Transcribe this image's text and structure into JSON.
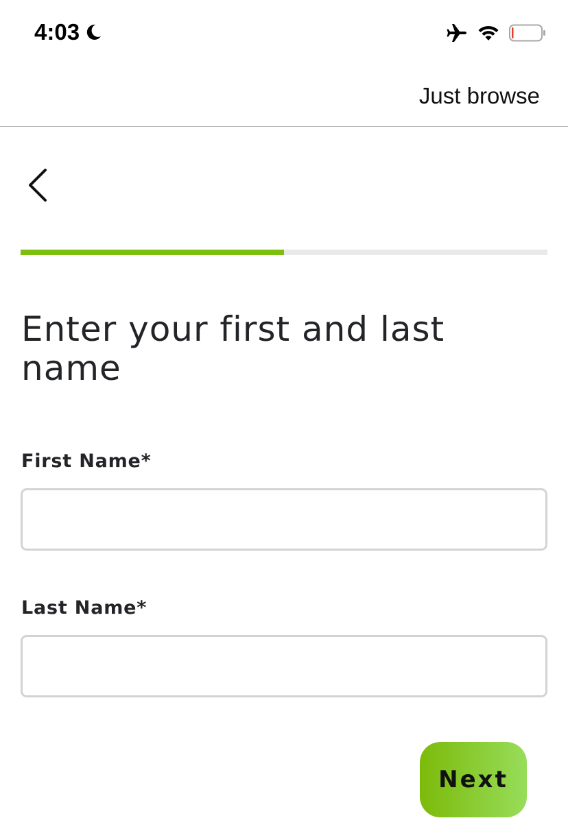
{
  "status_bar": {
    "time": "4:03",
    "icons": [
      "moon-icon",
      "airplane-icon",
      "wifi-icon",
      "battery-icon"
    ],
    "battery_level": 0.05
  },
  "top_bar": {
    "just_browse_label": "Just browse"
  },
  "navigation": {
    "back_icon": "chevron-left-icon"
  },
  "progress": {
    "fraction": 0.5,
    "fill_color": "#7cbf0f",
    "track_color": "#e9e9e9"
  },
  "form": {
    "title": "Enter your first and last name",
    "first_name": {
      "label": "First Name*",
      "value": "",
      "placeholder": ""
    },
    "last_name": {
      "label": "Last Name*",
      "value": "",
      "placeholder": ""
    },
    "next_label": "Next"
  },
  "colors": {
    "accent_start": "#7cba0a",
    "accent_end": "#97dd5a"
  }
}
